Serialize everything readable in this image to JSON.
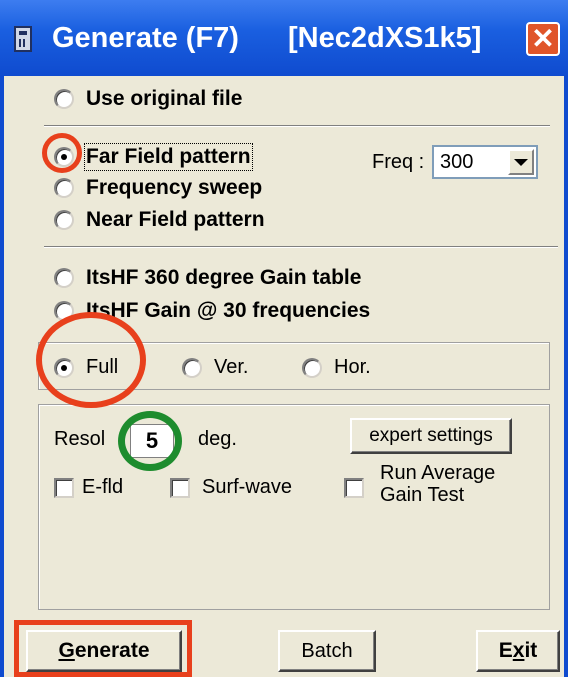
{
  "window": {
    "title": "Generate (F7)",
    "subtitle": "[Nec2dXS1k5]",
    "close_glyph": "✕"
  },
  "options": {
    "use_original": "Use original file",
    "far_field": "Far Field pattern",
    "freq_sweep": "Frequency sweep",
    "near_field": "Near Field pattern",
    "itshf_360": "ItsHF 360 degree Gain table",
    "itshf_30": "ItsHF Gain @ 30 frequencies",
    "selected": "far_field"
  },
  "freq": {
    "label": "Freq :",
    "value": "300"
  },
  "pattern": {
    "full": "Full",
    "ver": "Ver.",
    "hor": "Hor.",
    "selected": "full"
  },
  "settings": {
    "resolution_label": "Resol",
    "resolution_value": "5",
    "unit": "deg.",
    "expert_button": "expert settings",
    "efld": "E-fld",
    "surfwave": "Surf-wave",
    "run_avg_line1": "Run Average",
    "run_avg_line2": "Gain Test"
  },
  "buttons": {
    "generate_first": "G",
    "generate_rest": "enerate",
    "batch": "Batch",
    "exit_pre": "E",
    "exit_u": "x",
    "exit_post": "it"
  },
  "colors": {
    "title_bar": "#1a5fe0",
    "annotation_red": "#e8401c",
    "annotation_green": "#1e8c2e",
    "dialog_face": "#ece9d8"
  }
}
